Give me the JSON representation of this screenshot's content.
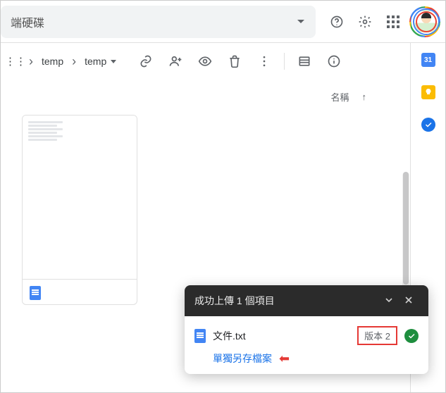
{
  "header": {
    "search_text": "端硬碟"
  },
  "breadcrumbs": {
    "item1": "temp",
    "item2": "temp"
  },
  "sort": {
    "label": "名稱"
  },
  "side": {
    "calendar_day": "31"
  },
  "toast": {
    "title": "成功上傳 1 個項目",
    "file_name": "文件.txt",
    "version_label": "版本 2",
    "keep_separate": "單獨另存檔案"
  }
}
